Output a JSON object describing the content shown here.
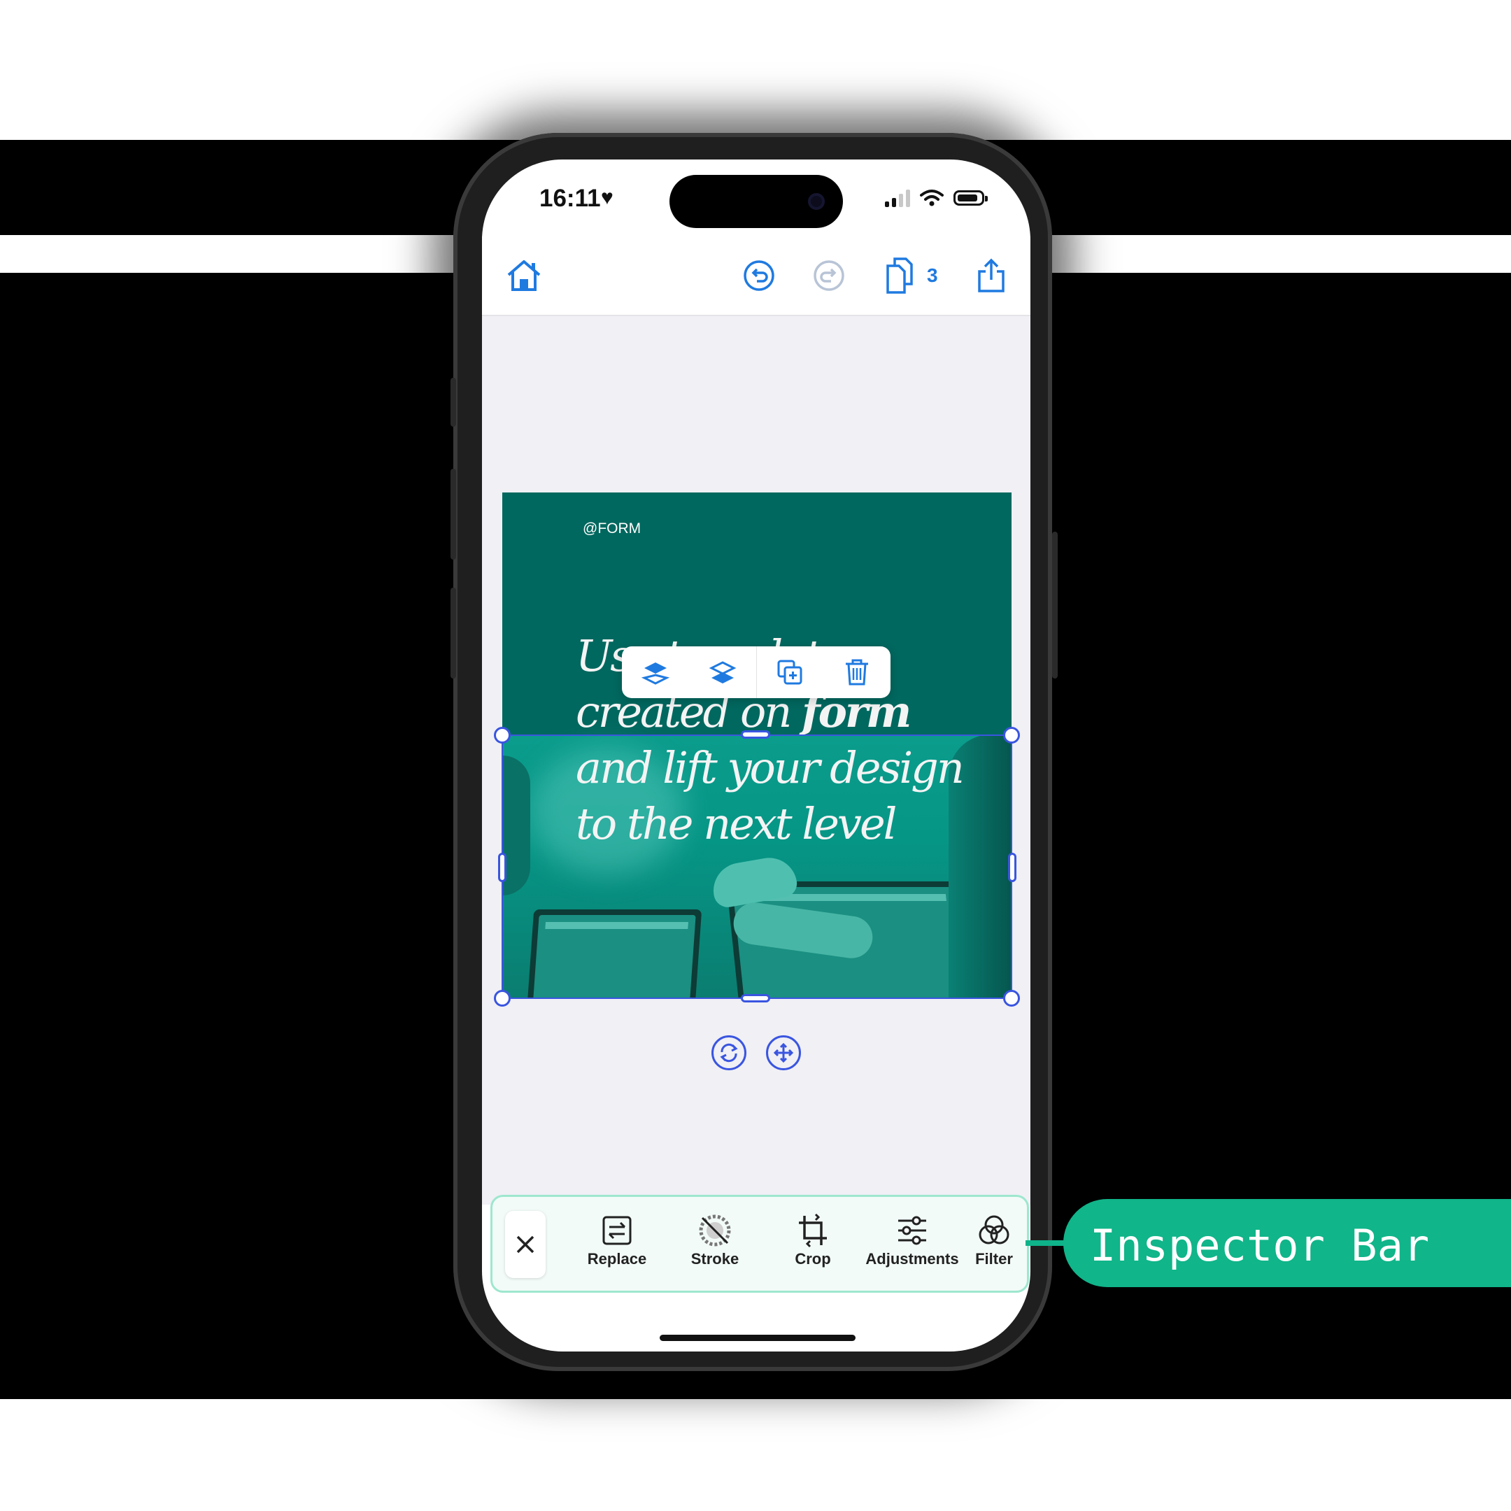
{
  "status_bar": {
    "time": "16:11",
    "heart": "♥"
  },
  "toolbar": {
    "home_icon": "home-icon",
    "undo_icon": "undo-icon",
    "redo_icon": "redo-icon",
    "pages_icon": "pages-icon",
    "page_count": "3",
    "share_icon": "share-icon"
  },
  "design": {
    "brand": "@FORM",
    "headline_lines": [
      "Use templates",
      "created on",
      "form",
      "and lift your design",
      "to the next level"
    ]
  },
  "context_menu": {
    "icons": [
      "bring-forward-icon",
      "send-backward-icon",
      "duplicate-icon",
      "delete-icon"
    ]
  },
  "inspector": {
    "close_icon": "close-icon",
    "items": [
      {
        "label": "Replace",
        "icon": "replace-icon"
      },
      {
        "label": "Stroke",
        "icon": "stroke-icon"
      },
      {
        "label": "Crop",
        "icon": "crop-icon"
      },
      {
        "label": "Adjustments",
        "icon": "adjustments-icon"
      },
      {
        "label": "Filter",
        "icon": "filter-icon"
      }
    ]
  },
  "callout": {
    "label": "Inspector Bar"
  },
  "colors": {
    "accent": "#1f7ae0",
    "selection": "#3a55e0",
    "design_bg": "#00685f",
    "callout": "#10b589"
  }
}
